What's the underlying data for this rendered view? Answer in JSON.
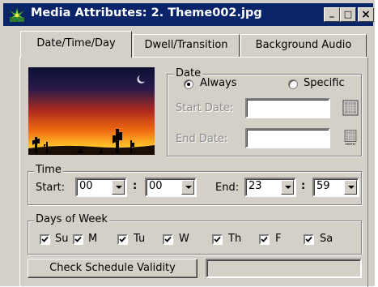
{
  "window": {
    "title": "Media Attributes: 2. Theme002.jpg",
    "controls": {
      "minimize": "_",
      "maximize": "□",
      "close": "×"
    }
  },
  "tabs": [
    {
      "label": "Date/Time/Day",
      "active": true
    },
    {
      "label": "Dwell/Transition",
      "active": false
    },
    {
      "label": "Background Audio",
      "active": false
    }
  ],
  "date": {
    "legend": "Date",
    "always_label": "Always",
    "specific_label": "Specific",
    "selected": "Always",
    "start_label": "Start Date:",
    "start_value": "",
    "end_label": "End Date:",
    "end_value": ""
  },
  "time": {
    "legend": "Time",
    "start_label": "Start:",
    "start_hour": "00",
    "start_minute": "00",
    "separator": ":",
    "end_label": "End:",
    "end_hour": "23",
    "end_minute": "59"
  },
  "days": {
    "legend": "Days of Week",
    "items": [
      {
        "label": "Su",
        "checked": true
      },
      {
        "label": "M",
        "checked": true
      },
      {
        "label": "Tu",
        "checked": true
      },
      {
        "label": "W",
        "checked": true
      },
      {
        "label": "Th",
        "checked": true
      },
      {
        "label": "F",
        "checked": true
      },
      {
        "label": "Sa",
        "checked": true
      }
    ]
  },
  "footer": {
    "check_button": "Check Schedule Validity",
    "status_value": ""
  },
  "colors": {
    "titlebar": "#0a246a",
    "face": "#d4d0c8"
  },
  "icons": [
    "app-icon",
    "calendar-icon",
    "checkmark-icon",
    "dropdown-arrow-icon"
  ]
}
